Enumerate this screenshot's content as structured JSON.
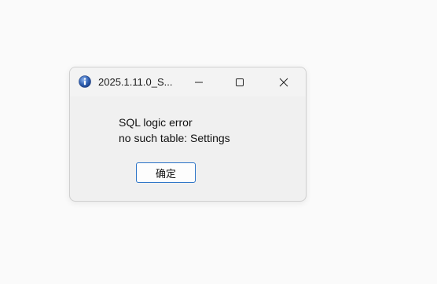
{
  "window": {
    "title": "2025.1.11.0_S...",
    "icon": "info-icon"
  },
  "titlebar_buttons": {
    "minimize": "minimize-icon",
    "maximize": "maximize-icon",
    "close": "close-icon"
  },
  "message": {
    "line1": "SQL logic error",
    "line2": "no such table: Settings"
  },
  "buttons": {
    "ok_label": "确定"
  },
  "colors": {
    "accent": "#2a73c7",
    "info_icon": "#2f5fb0"
  }
}
